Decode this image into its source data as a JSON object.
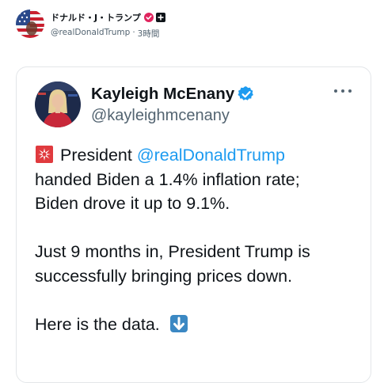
{
  "outer_post": {
    "author_name": "ドナルド・J・トランプ",
    "handle": "@realDonaldTrump",
    "separator": "·",
    "time": "3時間",
    "avatar": "flag-avatar",
    "badges": [
      "pink-verified-badge",
      "flag-badge"
    ]
  },
  "quoted_post": {
    "author_name": "Kayleigh McEnany",
    "handle": "@kayleighmcenany",
    "verified": "blue-verified-badge",
    "more_label": "more-options",
    "body": {
      "line1_emoji": "siren-emoji",
      "line1_text": "President ",
      "line1_mention": "@realDonaldTrump",
      "line2": "handed Biden a 1.4% inflation rate;",
      "line3": "Biden drove it up to 9.1%.",
      "line4": "Just 9 months in, President Trump is",
      "line5": "successfully bringing prices down.",
      "line6_text": "Here is the data.",
      "line6_emoji": "down-arrow-emoji"
    }
  },
  "colors": {
    "accent": "#1d9bf0",
    "text": "#0f1419",
    "muted": "#536471",
    "border": "#e3e6e9",
    "badge_pink": "#e0245e"
  }
}
